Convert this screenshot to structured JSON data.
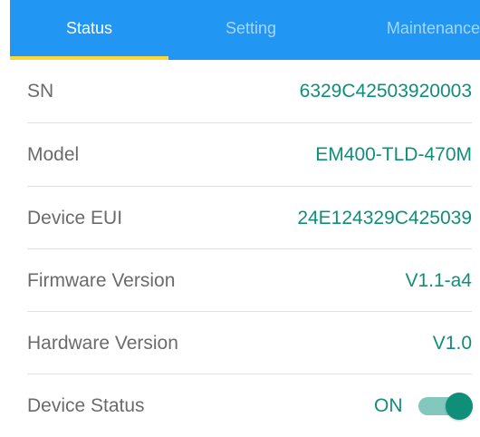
{
  "tabs": [
    {
      "label": "Status",
      "active": true
    },
    {
      "label": "Setting",
      "active": false
    },
    {
      "label": "Maintenance",
      "active": false
    }
  ],
  "rows": [
    {
      "label": "SN",
      "value": "6329C42503920003"
    },
    {
      "label": "Model",
      "value": "EM400-TLD-470M"
    },
    {
      "label": "Device EUI",
      "value": "24E124329C425039"
    },
    {
      "label": "Firmware Version",
      "value": "V1.1-a4"
    },
    {
      "label": "Hardware Version",
      "value": "V1.0"
    }
  ],
  "device_status": {
    "label": "Device Status",
    "value": "ON",
    "toggle_on": true
  },
  "colors": {
    "tab_bar": "#2196f3",
    "tab_indicator": "#fdd835",
    "value_text": "#0f8f7a",
    "label_text": "#6b6b6b",
    "toggle_knob": "#0f8f7a",
    "toggle_track": "#82c8be"
  }
}
